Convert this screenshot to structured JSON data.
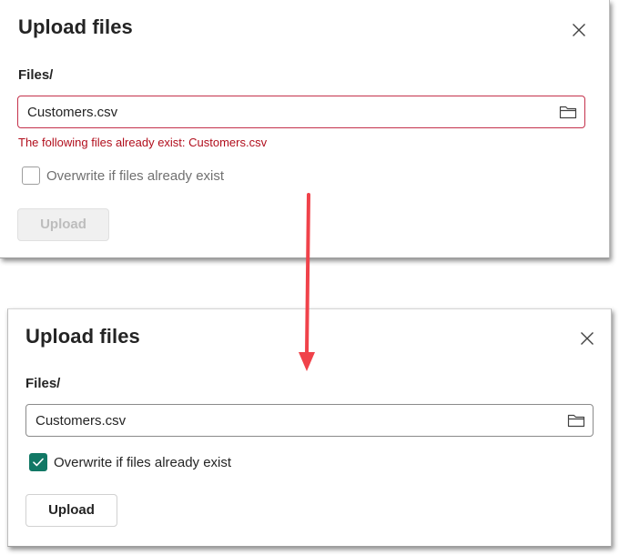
{
  "dialog_before": {
    "title": "Upload files",
    "path_label": "Files/",
    "file_input_value": "Customers.csv",
    "error_message": "The following files already exist: Customers.csv",
    "overwrite_label": "Overwrite if files already exist",
    "overwrite_checked": false,
    "upload_label": "Upload",
    "upload_enabled": false
  },
  "dialog_after": {
    "title": "Upload files",
    "path_label": "Files/",
    "file_input_value": "Customers.csv",
    "overwrite_label": "Overwrite if files already exist",
    "overwrite_checked": true,
    "upload_label": "Upload",
    "upload_enabled": true
  },
  "icons": {
    "close": "close-icon",
    "folder": "folder-icon",
    "check": "checkmark-icon",
    "annotation": "down-arrow-annotation"
  },
  "colors": {
    "error_text": "#b10e1c",
    "error_border": "#c4314b",
    "checkbox_checked": "#117865",
    "arrow": "#f0424a",
    "disabled_button_bg": "#f0f0f0",
    "disabled_text": "#bdbdbd"
  }
}
